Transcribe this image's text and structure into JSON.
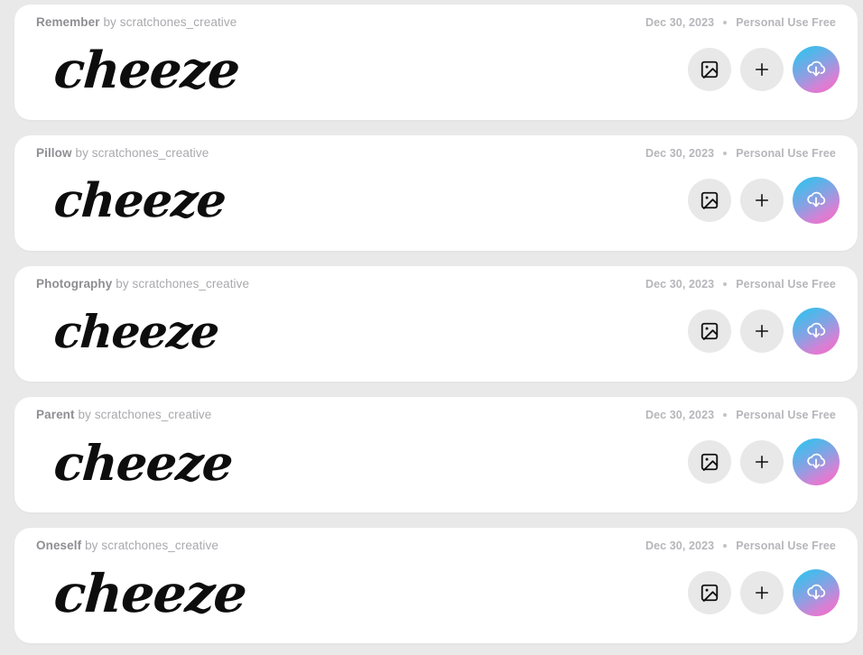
{
  "page": {
    "background_color": "#e9e9e9",
    "card_background": "#ffffff"
  },
  "theme": {
    "gradient_start": "#27c4f0",
    "gradient_end": "#f768c4",
    "button_bg": "#e8e8e8",
    "title_color": "#8e8e93",
    "meta_color": "#b6b6bb"
  },
  "common": {
    "by_label": "by",
    "separator_dot": "•",
    "preview_word": "cheeze",
    "image_icon_name": "image-icon",
    "plus_icon_name": "plus-icon",
    "download_icon_name": "cloud-download-icon"
  },
  "cards": [
    {
      "name": "Remember",
      "author": "scratchones_creative",
      "date": "Dec 30, 2023",
      "license": "Personal Use Free",
      "preview": "cheeze",
      "preview_size": "56px"
    },
    {
      "name": "Pillow",
      "author": "scratchones_creative",
      "date": "Dec 30, 2023",
      "license": "Personal Use Free",
      "preview": "cheeze",
      "preview_size": "52px"
    },
    {
      "name": "Photography",
      "author": "scratchones_creative",
      "date": "Dec 30, 2023",
      "license": "Personal Use Free",
      "preview": "cheeze",
      "preview_size": "50px"
    },
    {
      "name": "Parent",
      "author": "scratchones_creative",
      "date": "Dec 30, 2023",
      "license": "Personal Use Free",
      "preview": "cheeze",
      "preview_size": "54px"
    },
    {
      "name": "Oneself",
      "author": "scratchones_creative",
      "date": "Dec 30, 2023",
      "license": "Personal Use Free",
      "preview": "cheeze",
      "preview_size": "58px"
    }
  ]
}
